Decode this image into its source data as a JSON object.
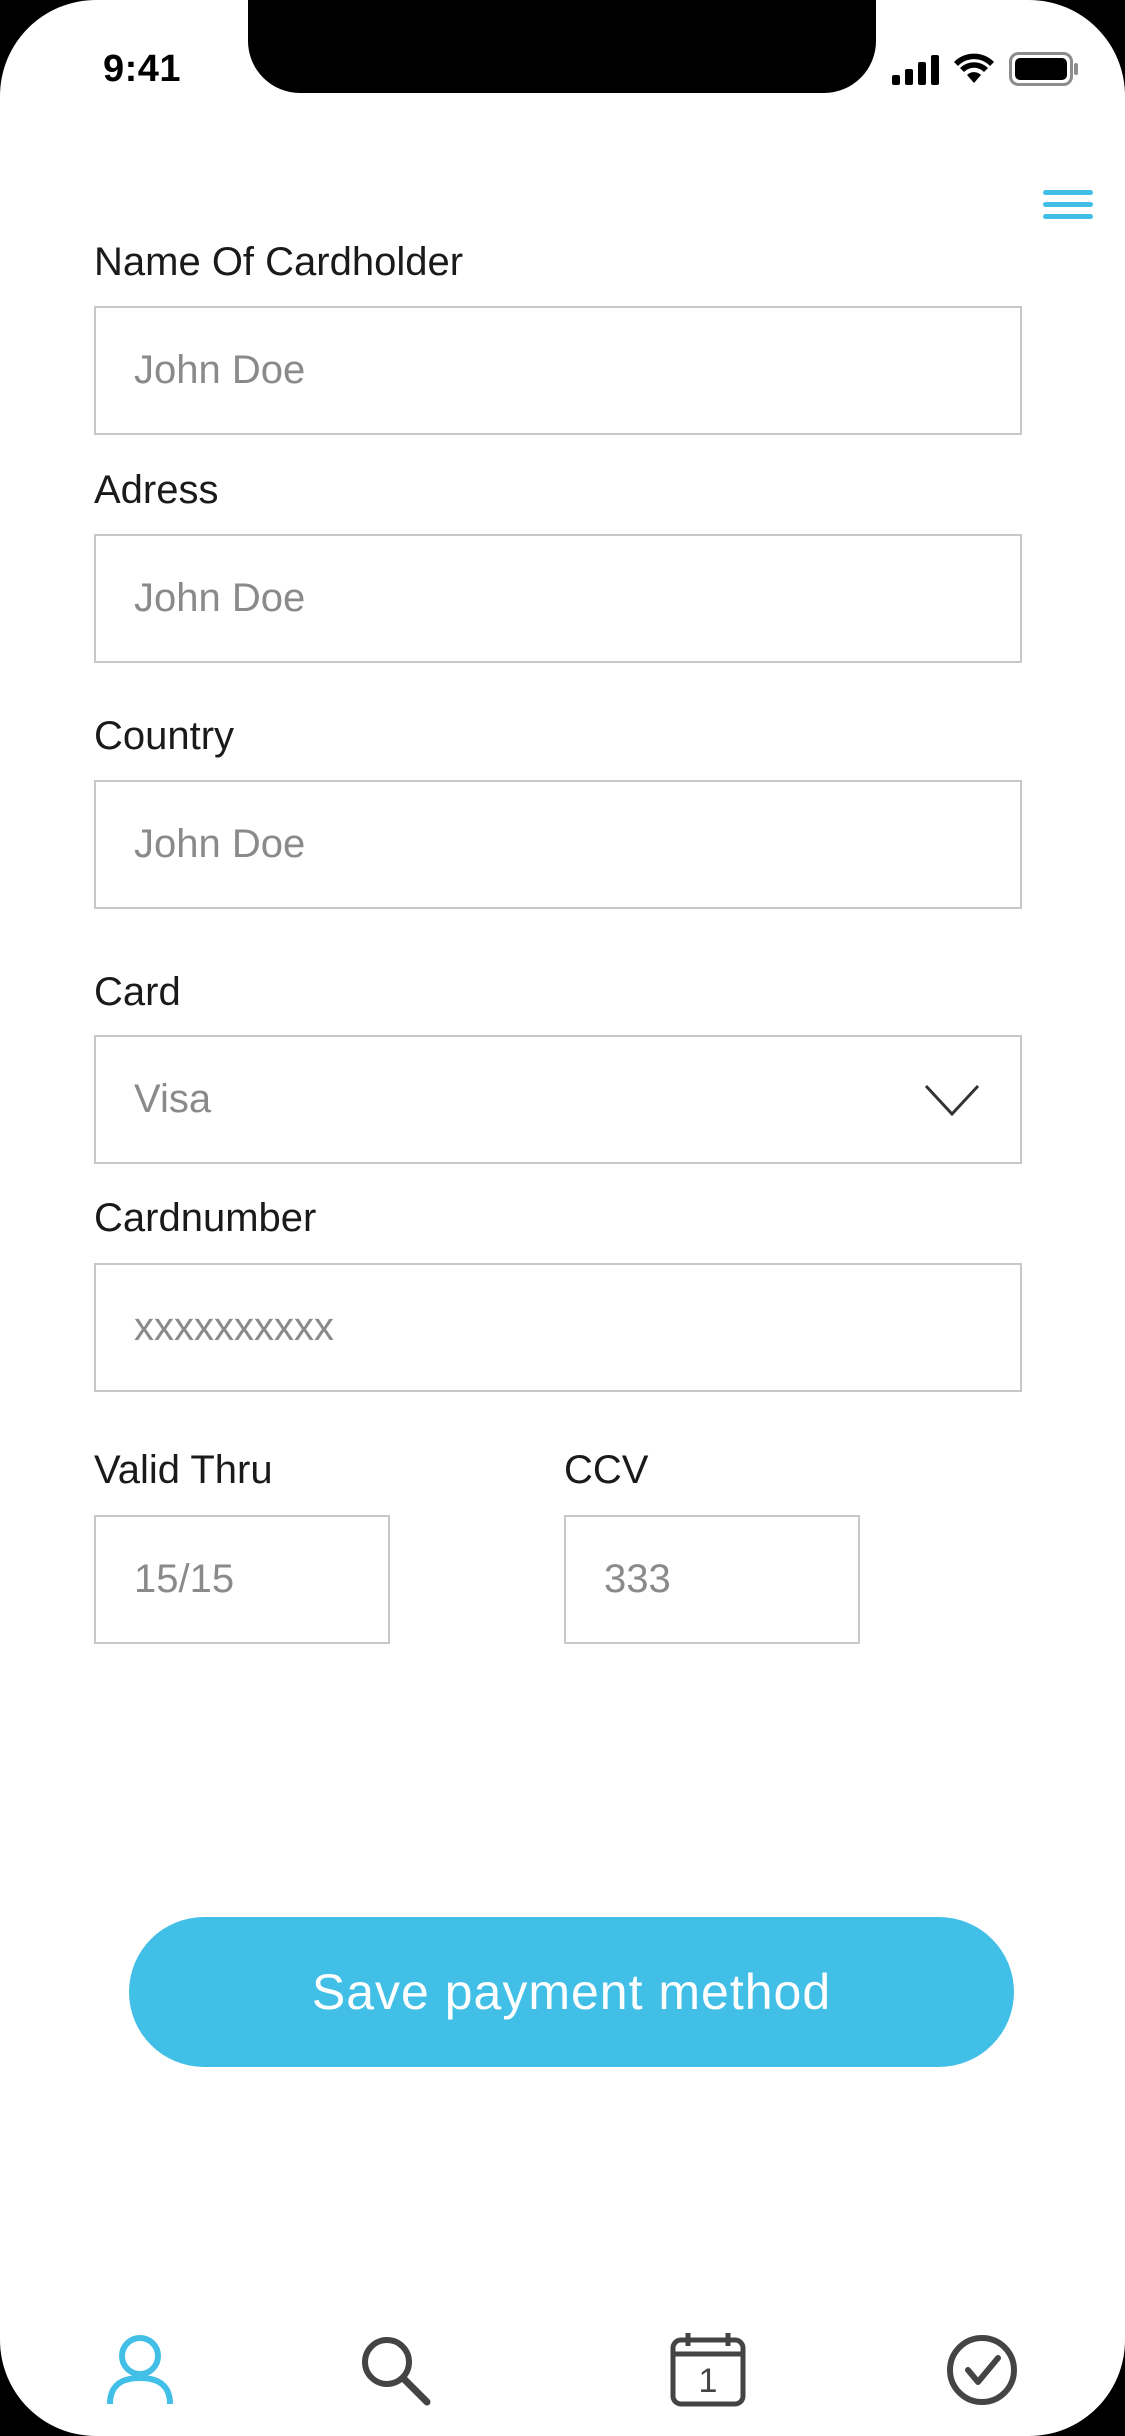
{
  "status_bar": {
    "time": "9:41"
  },
  "header": {
    "menu_icon": "hamburger-menu-icon",
    "accent_color": "#42bfe7"
  },
  "form": {
    "cardholder": {
      "label": "Name Of Cardholder",
      "placeholder": "John Doe"
    },
    "address": {
      "label": "Adress",
      "placeholder": "John Doe"
    },
    "country": {
      "label": "Country",
      "placeholder": "John Doe"
    },
    "card": {
      "label": "Card",
      "selected": "Visa"
    },
    "cardnumber": {
      "label": "Cardnumber",
      "placeholder": "xxxxxxxxxx"
    },
    "valid_thru": {
      "label": "Valid Thru",
      "placeholder": "15/15"
    },
    "ccv": {
      "label": "CCV",
      "placeholder": "333"
    }
  },
  "actions": {
    "save_label": "Save payment method"
  },
  "tabbar": {
    "items": [
      {
        "icon": "profile-icon",
        "active": true
      },
      {
        "icon": "search-icon",
        "active": false
      },
      {
        "icon": "calendar-icon",
        "active": false,
        "badge": "1"
      },
      {
        "icon": "checkmark-circle-icon",
        "active": false
      }
    ],
    "active_color": "#42bfe7",
    "inactive_color": "#444444"
  }
}
